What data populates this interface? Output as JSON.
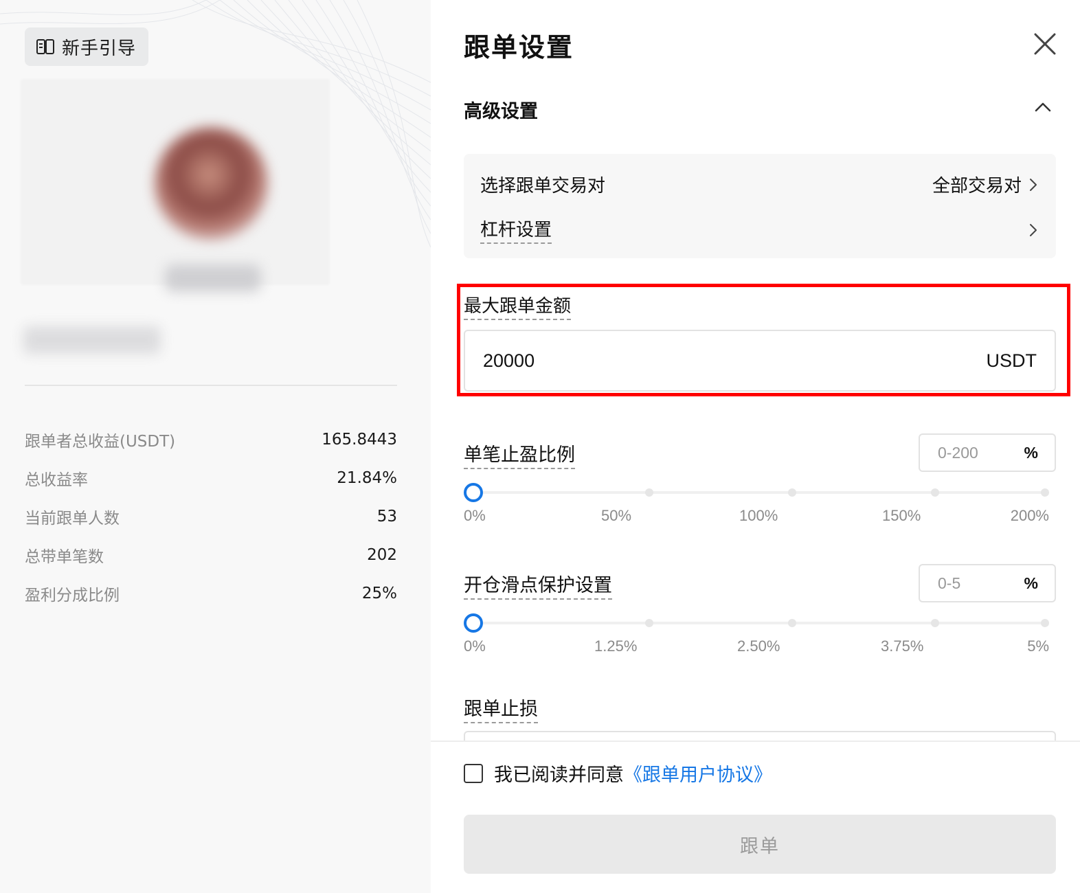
{
  "left_panel": {
    "guide_button_label": "新手引导",
    "stats": [
      {
        "label": "跟单者总收益(USDT)",
        "value": "165.8443"
      },
      {
        "label": "总收益率",
        "value": "21.84%"
      },
      {
        "label": "当前跟单人数",
        "value": "53"
      },
      {
        "label": "总带单笔数",
        "value": "202"
      },
      {
        "label": "盈利分成比例",
        "value": "25%"
      }
    ]
  },
  "dialog": {
    "title": "跟单设置",
    "advanced": {
      "title": "高级设置",
      "pair_label": "选择跟单交易对",
      "pair_value": "全部交易对",
      "leverage_label": "杠杆设置"
    },
    "max_amount": {
      "label": "最大跟单金额",
      "value": "20000",
      "unit": "USDT"
    },
    "take_profit": {
      "label": "单笔止盈比例",
      "placeholder": "0-200",
      "unit": "%",
      "slider_value_fraction": 0,
      "ticks": [
        "0%",
        "50%",
        "100%",
        "150%",
        "200%"
      ]
    },
    "slippage": {
      "label": "开仓滑点保护设置",
      "placeholder": "0-5",
      "unit": "%",
      "slider_value_fraction": 0,
      "ticks": [
        "0%",
        "1.25%",
        "2.50%",
        "3.75%",
        "5%"
      ]
    },
    "stop_loss": {
      "label": "跟单止损"
    },
    "agreement": {
      "text": "我已阅读并同意",
      "link": "《跟单用户协议》"
    },
    "submit_label": "跟单"
  },
  "colors": {
    "accent": "#1677e5",
    "highlight": "#ff0000",
    "disabled_bg": "#e9e9e9"
  },
  "icons": [
    "book-icon",
    "close-icon",
    "chevron-up-icon",
    "chevron-right-icon"
  ]
}
